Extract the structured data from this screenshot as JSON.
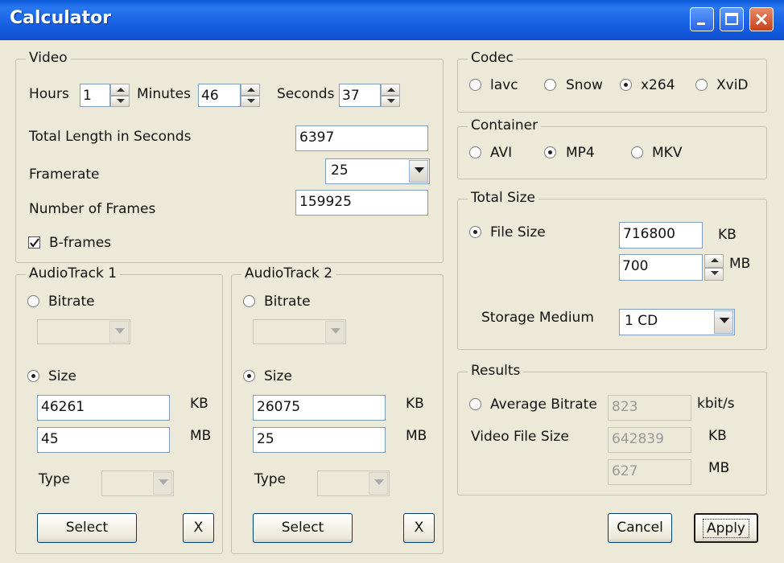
{
  "window": {
    "title": "Calculator"
  },
  "video": {
    "legend": "Video",
    "hours_label": "Hours",
    "hours": "1",
    "minutes_label": "Minutes",
    "minutes": "46",
    "seconds_label": "Seconds",
    "seconds": "37",
    "total_label": "Total Length in Seconds",
    "total": "6397",
    "framerate_label": "Framerate",
    "framerate": "25",
    "frames_label": "Number of Frames",
    "frames": "159925",
    "bframes_label": "B-frames",
    "bframes_checked": true
  },
  "audio1": {
    "legend": "AudioTrack 1",
    "bitrate_label": "Bitrate",
    "bitrate_selected": false,
    "size_label": "Size",
    "size_selected": true,
    "kb": "46261",
    "kb_unit": "KB",
    "mb": "45",
    "mb_unit": "MB",
    "type_label": "Type",
    "select_label": "Select",
    "clear_label": "X"
  },
  "audio2": {
    "legend": "AudioTrack 2",
    "bitrate_label": "Bitrate",
    "bitrate_selected": false,
    "size_label": "Size",
    "size_selected": true,
    "kb": "26075",
    "kb_unit": "KB",
    "mb": "25",
    "mb_unit": "MB",
    "type_label": "Type",
    "select_label": "Select",
    "clear_label": "X"
  },
  "codec": {
    "legend": "Codec",
    "options": [
      "lavc",
      "Snow",
      "x264",
      "XviD"
    ],
    "selected": "x264"
  },
  "container": {
    "legend": "Container",
    "options": [
      "AVI",
      "MP4",
      "MKV"
    ],
    "selected": "MP4"
  },
  "total_size": {
    "legend": "Total Size",
    "file_size_label": "File Size",
    "file_size_selected": true,
    "kb": "716800",
    "kb_unit": "KB",
    "mb": "700",
    "mb_unit": "MB",
    "storage_label": "Storage Medium",
    "storage": "1 CD"
  },
  "results": {
    "legend": "Results",
    "avg_bitrate_label": "Average Bitrate",
    "avg_bitrate": "823",
    "avg_bitrate_unit": "kbit/s",
    "video_size_label": "Video File Size",
    "video_kb": "642839",
    "kb_unit": "KB",
    "video_mb": "627",
    "mb_unit": "MB"
  },
  "buttons": {
    "cancel": "Cancel",
    "apply": "Apply"
  }
}
